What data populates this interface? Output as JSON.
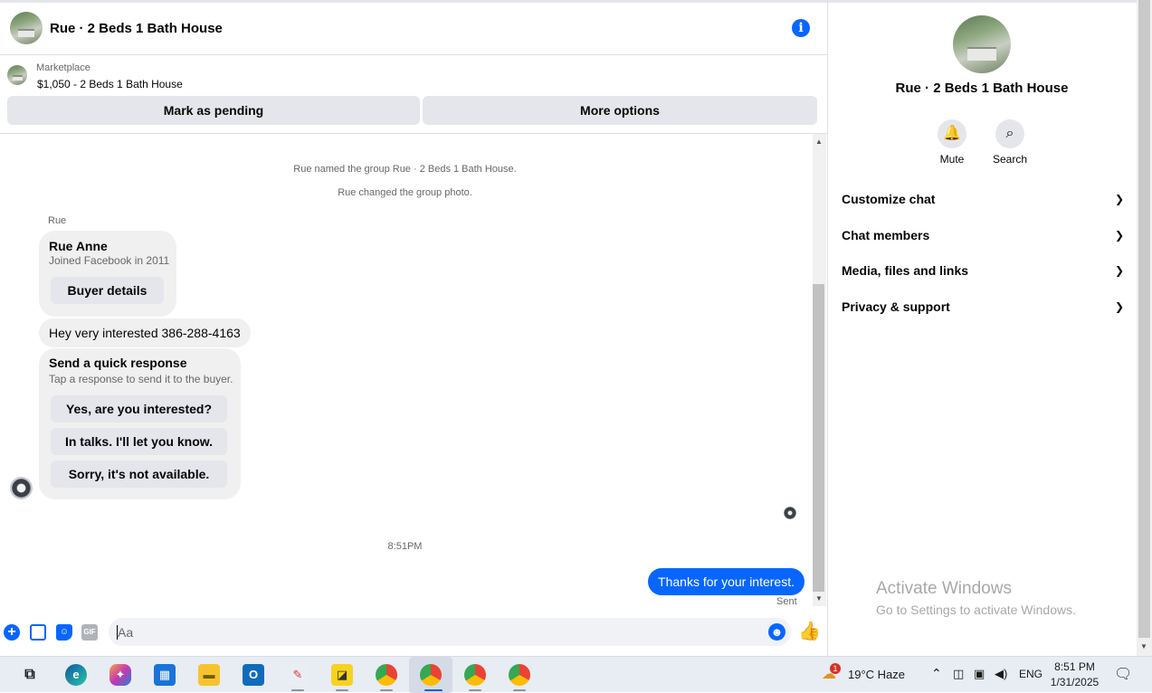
{
  "header": {
    "title": "Rue · 2 Beds 1 Bath House",
    "info_icon": "info-icon"
  },
  "marketplace": {
    "label": "Marketplace",
    "listing": "$1,050 - 2 Beds 1 Bath House",
    "mark_pending": "Mark as pending",
    "more_options": "More options"
  },
  "messages": {
    "system1": "Rue named the group Rue · 2 Beds 1 Bath House.",
    "system2": "Rue changed the group photo.",
    "sender": "Rue",
    "profile": {
      "name": "Rue Anne",
      "joined": "Joined Facebook in 2011",
      "button": "Buyer details"
    },
    "incoming": "Hey very interested 386-288-4163",
    "quick": {
      "title": "Send a quick response",
      "subtitle": "Tap a response to send it to the buyer.",
      "options": [
        "Yes, are you interested?",
        "In talks. I'll let you know.",
        "Sorry, it's not available."
      ]
    },
    "time": "8:51PM",
    "outgoing": "Thanks for your interest.",
    "status": "Sent"
  },
  "composer": {
    "placeholder": "Aa"
  },
  "right_panel": {
    "title": "Rue · 2 Beds 1 Bath House",
    "actions": {
      "mute": "Mute",
      "search": "Search"
    },
    "sections": [
      "Customize chat",
      "Chat members",
      "Media, files and links",
      "Privacy & support"
    ]
  },
  "watermark": {
    "line1": "Activate Windows",
    "line2": "Go to Settings to activate Windows."
  },
  "taskbar": {
    "weather": "19°C  Haze",
    "weather_badge": "1",
    "language": "ENG",
    "time": "8:51 PM",
    "date": "1/31/2025"
  },
  "colors": {
    "accent": "#0866ff",
    "bubble": "#f0f0f0",
    "button": "#e4e6eb"
  }
}
